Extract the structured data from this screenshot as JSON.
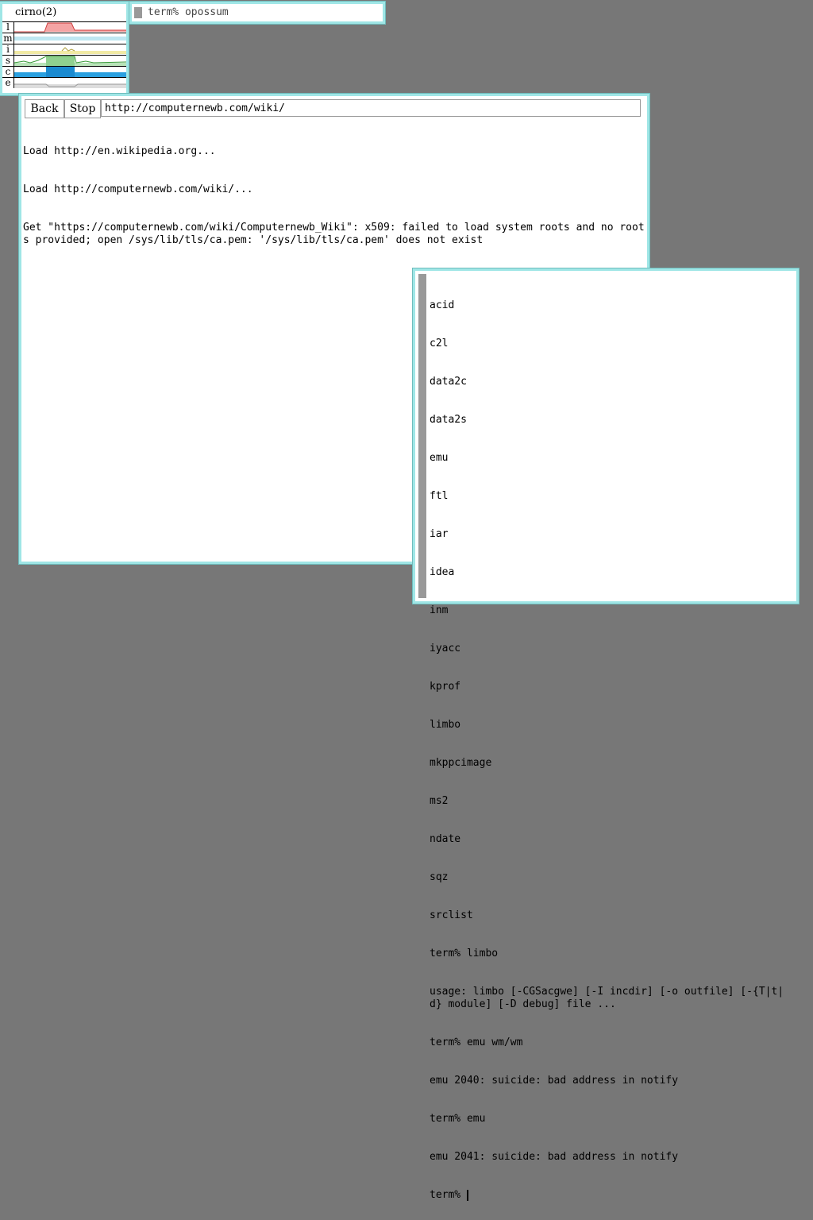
{
  "stats": {
    "title": "cirno(2)",
    "rows": [
      "l",
      "m",
      "i",
      "s",
      "c",
      "e"
    ]
  },
  "term_small": {
    "line": "term% opossum"
  },
  "browser": {
    "back_label": "Back",
    "stop_label": "Stop",
    "url": "http://computernewb.com/wiki/",
    "log": [
      "Load http://en.wikipedia.org...",
      "Load http://computernewb.com/wiki/...",
      "Get \"https://computernewb.com/wiki/Computernewb_Wiki\": x509: failed to load system roots and no roots provided; open /sys/lib/tls/ca.pem: '/sys/lib/tls/ca.pem' does not exist"
    ]
  },
  "term_big": {
    "lines": [
      "acid",
      "c2l",
      "data2c",
      "data2s",
      "emu",
      "ftl",
      "iar",
      "idea",
      "inm",
      "iyacc",
      "kprof",
      "limbo",
      "mkppcimage",
      "ms2",
      "ndate",
      "sqz",
      "srclist",
      "term% limbo",
      "usage: limbo [-CGSacgwe] [-I incdir] [-o outfile] [-{T|t|d} module] [-D debug] file ...",
      "term% emu wm/wm",
      "emu 2040: suicide: bad address in notify",
      "term% emu",
      "emu 2041: suicide: bad address in notify",
      "term% "
    ]
  },
  "colors": {
    "desktop": "#777777",
    "window_border": "#9fe6e6",
    "stats_red": "#f4a4a4",
    "stats_green": "#8fd08f",
    "stats_blue": "#2aa0e0"
  }
}
